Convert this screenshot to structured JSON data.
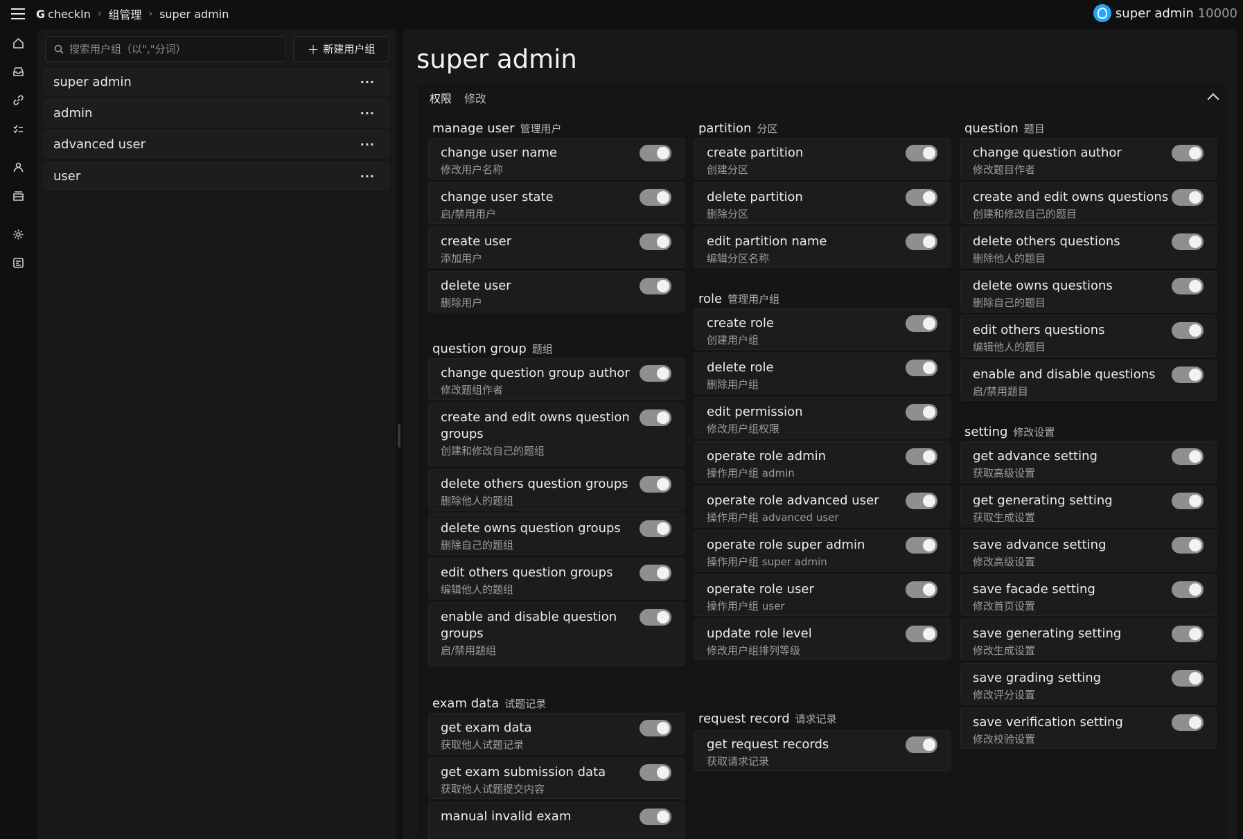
{
  "topbar": {
    "brand": "checkIn",
    "breadcrumb": [
      "组管理",
      "super admin"
    ],
    "user_name": "super admin",
    "user_id": "10000"
  },
  "rail_icons": [
    "home-icon",
    "inbox-icon",
    "link-icon",
    "checklist-icon",
    "person-icon",
    "archive-icon",
    "gear-icon",
    "dashboard-icon"
  ],
  "groups": {
    "search_placeholder": "搜索用户组（以\",\"分词）",
    "new_button": "新建用户组",
    "items": [
      {
        "label": "super admin"
      },
      {
        "label": "admin"
      },
      {
        "label": "advanced user"
      },
      {
        "label": "user"
      }
    ],
    "more_label": "···"
  },
  "main": {
    "title": "super admin",
    "tabs": [
      "权限",
      "修改"
    ],
    "toggle_state": "on"
  },
  "sections": {
    "manage_user": {
      "title": "manage user",
      "zh": "管理用户",
      "items": [
        {
          "en": "change user name",
          "cn": "修改用户名称"
        },
        {
          "en": "change user state",
          "cn": "启/禁用用户"
        },
        {
          "en": "create user",
          "cn": "添加用户"
        },
        {
          "en": "delete user",
          "cn": "删除用户"
        }
      ]
    },
    "question_group": {
      "title": "question group",
      "zh": "题组",
      "items": [
        {
          "en": "change question group author",
          "cn": "修改题组作者"
        },
        {
          "en": "create and edit owns question groups",
          "cn": "创建和修改自己的题组"
        },
        {
          "en": "delete others question groups",
          "cn": "删除他人的题组"
        },
        {
          "en": "delete owns question groups",
          "cn": "删除自己的题组"
        },
        {
          "en": "edit others question groups",
          "cn": "编辑他人的题组"
        },
        {
          "en": "enable and disable question groups",
          "cn": "启/禁用题组"
        }
      ]
    },
    "exam_data": {
      "title": "exam data",
      "zh": "试题记录",
      "items": [
        {
          "en": "get exam data",
          "cn": "获取他人试题记录"
        },
        {
          "en": "get exam submission data",
          "cn": "获取他人试题提交内容"
        },
        {
          "en": "manual invalid exam",
          "cn": ""
        }
      ]
    },
    "partition": {
      "title": "partition",
      "zh": "分区",
      "items": [
        {
          "en": "create partition",
          "cn": "创建分区"
        },
        {
          "en": "delete partition",
          "cn": "删除分区"
        },
        {
          "en": "edit partition name",
          "cn": "编辑分区名称"
        }
      ]
    },
    "role": {
      "title": "role",
      "zh": "管理用户组",
      "items": [
        {
          "en": "create role",
          "cn": "创建用户组"
        },
        {
          "en": "delete role",
          "cn": "删除用户组"
        },
        {
          "en": "edit permission",
          "cn": "修改用户组权限"
        },
        {
          "en": "operate role admin",
          "cn": "操作用户组 admin"
        },
        {
          "en": "operate role advanced user",
          "cn": "操作用户组 advanced user"
        },
        {
          "en": "operate role super admin",
          "cn": "操作用户组 super admin"
        },
        {
          "en": "operate role user",
          "cn": "操作用户组 user"
        },
        {
          "en": "update role level",
          "cn": "修改用户组排列等级"
        }
      ]
    },
    "request_record": {
      "title": "request record",
      "zh": "请求记录",
      "items": [
        {
          "en": "get request records",
          "cn": "获取请求记录"
        }
      ]
    },
    "question": {
      "title": "question",
      "zh": "题目",
      "items": [
        {
          "en": "change question author",
          "cn": "修改题目作者"
        },
        {
          "en": "create and edit owns questions",
          "cn": "创建和修改自己的题目"
        },
        {
          "en": "delete others questions",
          "cn": "删除他人的题目"
        },
        {
          "en": "delete owns questions",
          "cn": "删除自己的题目"
        },
        {
          "en": "edit others questions",
          "cn": "编辑他人的题目"
        },
        {
          "en": "enable and disable questions",
          "cn": "启/禁用题目"
        }
      ]
    },
    "setting": {
      "title": "setting",
      "zh": "修改设置",
      "items": [
        {
          "en": "get advance setting",
          "cn": "获取高级设置"
        },
        {
          "en": "get generating setting",
          "cn": "获取生成设置"
        },
        {
          "en": "save advance setting",
          "cn": "修改高级设置"
        },
        {
          "en": "save facade setting",
          "cn": "修改首页设置"
        },
        {
          "en": "save generating setting",
          "cn": "修改生成设置"
        },
        {
          "en": "save grading setting",
          "cn": "修改评分设置"
        },
        {
          "en": "save verification setting",
          "cn": "修改校验设置"
        }
      ]
    }
  }
}
